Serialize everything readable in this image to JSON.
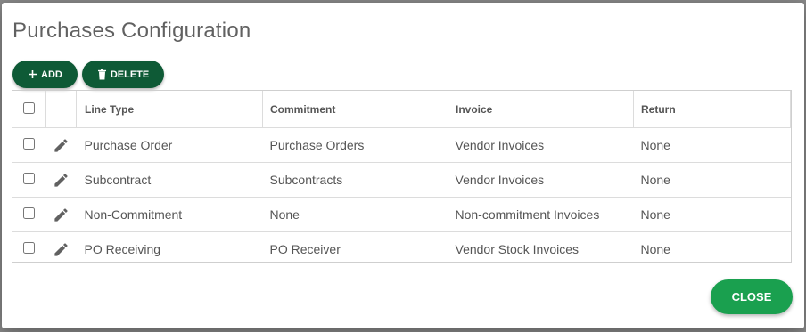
{
  "dialog": {
    "title": "Purchases Configuration"
  },
  "toolbar": {
    "add_label": "ADD",
    "delete_label": "DELETE",
    "button_color": "#0e5a36"
  },
  "table": {
    "columns": [
      "Line Type",
      "Commitment",
      "Invoice",
      "Return"
    ],
    "rows": [
      {
        "line_type": "Purchase Order",
        "commitment": "Purchase Orders",
        "invoice": "Vendor Invoices",
        "return": "None"
      },
      {
        "line_type": "Subcontract",
        "commitment": "Subcontracts",
        "invoice": "Vendor Invoices",
        "return": "None"
      },
      {
        "line_type": "Non-Commitment",
        "commitment": "None",
        "invoice": "Non-commitment Invoices",
        "return": "None"
      },
      {
        "line_type": "PO Receiving",
        "commitment": "PO Receiver",
        "invoice": "Vendor Stock Invoices",
        "return": "None"
      }
    ]
  },
  "footer": {
    "close_label": "CLOSE",
    "close_color": "#1aa04f"
  },
  "icons": {
    "add": "plus-icon",
    "delete": "trash-icon",
    "edit": "pencil-icon"
  }
}
